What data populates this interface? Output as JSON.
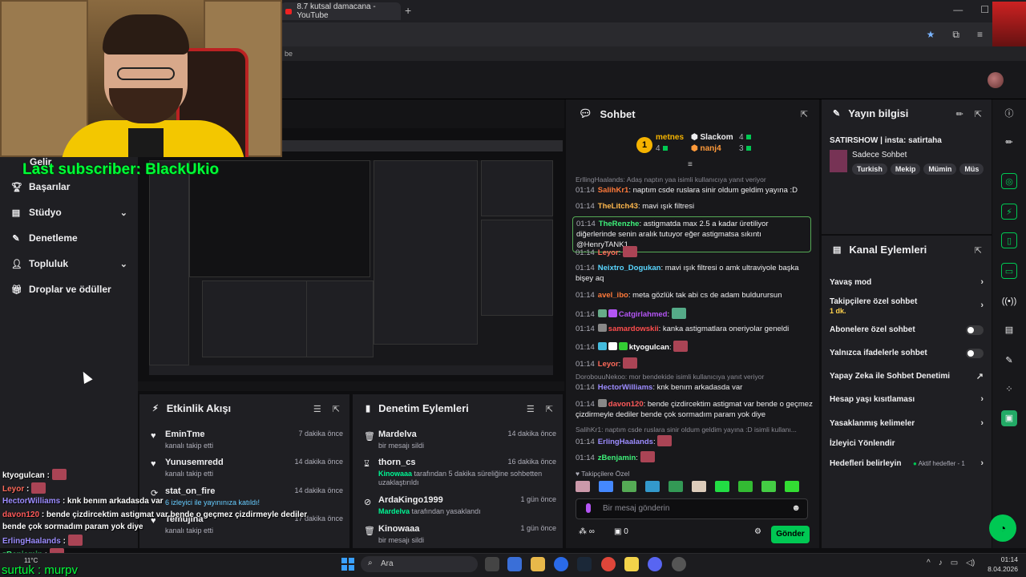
{
  "browser": {
    "tab_title": "8.7 kutsal damacana - YouTube",
    "bookmark_text": "be"
  },
  "overlay": {
    "last_subscriber": "Last subscriber: BlackUkio",
    "bottom_user": "surtuk : murpv",
    "weather": "11°C",
    "chat": [
      {
        "user": "ktyogulcan",
        "text": ":",
        "color": "#ffffff"
      },
      {
        "user": "Leyor",
        "text": ":",
        "color": "#ff6a5a"
      },
      {
        "user": "HectorWilliams",
        "text": ": knk benım arkadasda var",
        "color": "#9c8cff"
      },
      {
        "user": "davon120",
        "text": ": bende çizdircektim astigmat var bende o geçmez çizdirmeyle dediler",
        "color": "#ff5a5a"
      },
      {
        "user": "",
        "text": "bende çok sormadım param yok diye",
        "color": "#ffffff"
      },
      {
        "user": "ErlingHaalands",
        "text": ":",
        "color": "#9c8cff"
      },
      {
        "user": "zBenjamin",
        "text": ":",
        "color": "#3ef07a"
      }
    ]
  },
  "leftnav": {
    "partial_top": "Gelir",
    "items": [
      {
        "label": "Başarılar",
        "icon": "trophy-icon",
        "chev": false
      },
      {
        "label": "Stüdyo",
        "icon": "studio-icon",
        "chev": true
      },
      {
        "label": "Denetleme",
        "icon": "wrench-icon",
        "chev": false
      },
      {
        "label": "Topluluk",
        "icon": "community-icon",
        "chev": true
      },
      {
        "label": "Droplar ve ödüller",
        "icon": "gift-icon",
        "chev": false
      }
    ]
  },
  "activity": {
    "title": "Etkinlik Akışı",
    "items": [
      {
        "name": "EminTme",
        "sub": "kanalı takip etti",
        "time": "7 dakika önce",
        "icon": "heart-icon"
      },
      {
        "name": "Yunusemredd",
        "sub": "kanalı takip etti",
        "time": "14 dakika önce",
        "icon": "heart-icon"
      },
      {
        "name": "stat_on_fire",
        "sub": "6 izleyici ile yayınınıza katıldı!",
        "time": "14 dakika önce",
        "icon": "raid-icon"
      },
      {
        "name": "Temujina",
        "sub": "kanalı takip etti",
        "time": "17 dakika önce",
        "icon": "heart-icon"
      }
    ]
  },
  "mod_actions": {
    "title": "Denetim Eylemleri",
    "items": [
      {
        "name": "Mardelva",
        "sub": "bir mesajı sildi",
        "sub_hl": "",
        "sub2": "",
        "time": "14 dakika önce",
        "icon": "trash-icon"
      },
      {
        "name": "thorn_cs",
        "sub_hl": "Kinowaaa",
        "sub": " tarafından 5 dakika süreliğine sohbetten",
        "sub2": "uzaklaştırıldı",
        "time": "16 dakika önce",
        "icon": "hourglass-icon"
      },
      {
        "name": "ArdaKingo1999",
        "sub_hl": "Mardelva",
        "sub": " tarafından yasaklandı",
        "sub2": "",
        "time": "1 gün önce",
        "icon": "ban-icon"
      },
      {
        "name": "Kinowaaa",
        "sub": "bir mesajı sildi",
        "sub_hl": "",
        "sub2": "",
        "time": "1 gün önce",
        "icon": "trash-icon"
      }
    ]
  },
  "chat": {
    "title": "Sohbet",
    "leaderboard": {
      "rank": "1",
      "first": {
        "name": "metnes",
        "value": "4"
      },
      "second": {
        "name": "Slackom",
        "value": "4"
      },
      "third": {
        "name": "nanj4",
        "value": "3"
      }
    },
    "messages": [
      {
        "type": "reply",
        "text": "ErllingHaalands: Adaş naptın yaa isimli kullanıcıya yanıt veriyor"
      },
      {
        "time": "01:14",
        "user": "SalihKr1",
        "color": "#ff7a3a",
        "text": ": naptım csde ruslara sinir oldum geldim yayına :D"
      },
      {
        "time": "01:14",
        "user": "TheLitch43",
        "color": "#ffb84d",
        "text": ": mavi ışık filtresi"
      },
      {
        "time": "01:14",
        "user": "TheRenzhe",
        "color": "#3ef07a",
        "text": ": astigmatda max 2.5 a kadar üretiliyor diğerlerinde senin aralık tutuyor eğer astigmatsa sıkıntı @HenryTANK1",
        "highlight": true
      },
      {
        "time": "01:14",
        "user": "Leyor",
        "color": "#ff6a5a",
        "text": ":",
        "emote": true
      },
      {
        "time": "01:14",
        "user": "Neixtro_Dogukan",
        "color": "#5ad6ff",
        "text": ": mavi ışık filtresi o amk ultraviyole başka bişey aq"
      },
      {
        "time": "01:14",
        "user": "avel_ibo",
        "color": "#ff7a3a",
        "text": ": meta gözlük tak abi cs de adam buldurursun"
      },
      {
        "time": "01:14",
        "user": "Catgirlahmed",
        "color": "#b455f5",
        "text": ":",
        "emote": true
      },
      {
        "time": "01:14",
        "user": "samardowskii",
        "color": "#ff4d4d",
        "text": ": kanka astigmatlara oneriyolar geneldi"
      },
      {
        "time": "01:14",
        "user": "ktyogulcan",
        "color": "#ffffff",
        "text": ":",
        "emote": true
      },
      {
        "time": "01:14",
        "user": "Leyor",
        "color": "#ff6a5a",
        "text": ":",
        "emote": true
      },
      {
        "type": "reply",
        "text": "DorobouuNekoo: mor bendekide isimli kullanıcıya yanıt veriyor"
      },
      {
        "time": "01:14",
        "user": "HectorWilliams",
        "color": "#9c8cff",
        "text": ": knk benım arkadasda var"
      },
      {
        "time": "01:14",
        "user": "davon120",
        "color": "#ff5a5a",
        "text": ": bende çizdircektim astigmat var bende o geçmez çizdirmeyle dediler bende çok sormadım param yok diye"
      },
      {
        "type": "reply",
        "text": "SalihKr1: naptım csde ruslara sinir oldum geldim yayına :D isimli kullanı..."
      },
      {
        "time": "01:14",
        "user": "ErlingHaalands",
        "color": "#9c8cff",
        "text": ":",
        "emote": true
      },
      {
        "time": "01:14",
        "user": "zBenjamin",
        "color": "#3ef07a",
        "text": ":",
        "emote": true
      }
    ],
    "subs_only_label": "Takipçilere Özel",
    "input_placeholder": "Bir mesaj gönderin",
    "points": "∞",
    "gifts": "0",
    "send_label": "Gönder"
  },
  "stream_info": {
    "title": "Yayın bilgisi",
    "stream_title": "SATIRSHOW | insta: satirtaha",
    "category": "Sadece Sohbet",
    "tags": [
      "Turkish",
      "Mekip",
      "Mümin",
      "Müs"
    ]
  },
  "channel_actions": {
    "title": "Kanal Eylemleri",
    "items": [
      {
        "label": "Yavaş mod",
        "kind": "chev"
      },
      {
        "label": "Takipçilere özel sohbet",
        "kind": "chev",
        "sub": "1 dk."
      },
      {
        "label": "Abonelere özel sohbet",
        "kind": "toggle"
      },
      {
        "label": "Yalnızca ifadelerle sohbet",
        "kind": "toggle"
      },
      {
        "label": "Yapay Zeka ile Sohbet Denetimi",
        "kind": "ext"
      },
      {
        "label": "Hesap yaşı kısıtlaması",
        "kind": "chev"
      },
      {
        "label": "Yasaklanmış kelimeler",
        "kind": "chev"
      },
      {
        "label": "İzleyici Yönlendir",
        "kind": "none"
      },
      {
        "label": "Hedefleri belirleyin",
        "kind": "chev",
        "right_text": "Aktif hedefler - 1"
      }
    ]
  },
  "taskbar": {
    "search": "Ara",
    "time": "01:14",
    "date": "8.04.2026"
  },
  "colors": {
    "accent": "#00c853",
    "overlay_green": "#00ff3a",
    "bg": "#18181b"
  }
}
